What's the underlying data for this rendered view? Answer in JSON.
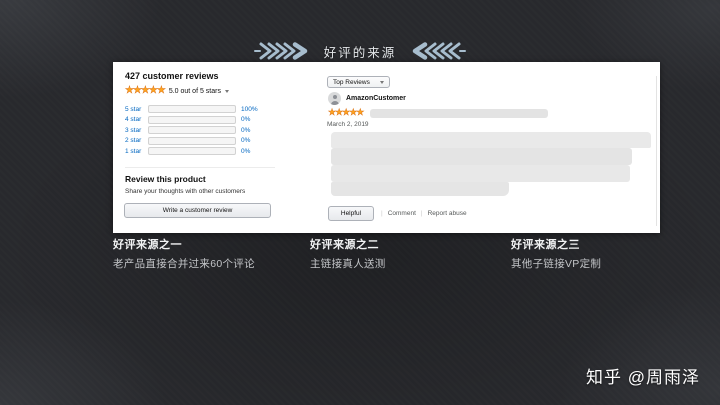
{
  "header": {
    "title": "好评的来源"
  },
  "panel": {
    "summary": {
      "heading": "427 customer reviews",
      "stars": "★★★★★",
      "rating_text": "5.0 out of 5 stars",
      "histogram": [
        {
          "label": "5 star",
          "value": 100,
          "percent": "100%"
        },
        {
          "label": "4 star",
          "value": 0,
          "percent": "0%"
        },
        {
          "label": "3 star",
          "value": 0,
          "percent": "0%"
        },
        {
          "label": "2 star",
          "value": 0,
          "percent": "0%"
        },
        {
          "label": "1 star",
          "value": 0,
          "percent": "0%"
        }
      ],
      "review_cta": {
        "heading": "Review this product",
        "subtext": "Share your thoughts with other customers",
        "button_label": "Write a customer review"
      }
    },
    "review": {
      "sort_label": "Top Reviews",
      "reviewer_name": "AmazonCustomer",
      "stars": "★★★★★",
      "date": "March 2, 2019",
      "helpful_button": "Helpful",
      "comment_link": "Comment",
      "report_link": "Report abuse"
    }
  },
  "captions": [
    {
      "title": "好评来源之一",
      "body": "老产品直接合并过来60个评论"
    },
    {
      "title": "好评来源之二",
      "body": "主链接真人送测"
    },
    {
      "title": "好评来源之三",
      "body": "其他子链接VP定制"
    }
  ],
  "watermark": "知乎 @周雨泽",
  "colors": {
    "star_orange": "#FFA41C",
    "link_blue": "#0066C0",
    "arrow_blue": "#A7BDCE",
    "background": "#28292D"
  }
}
